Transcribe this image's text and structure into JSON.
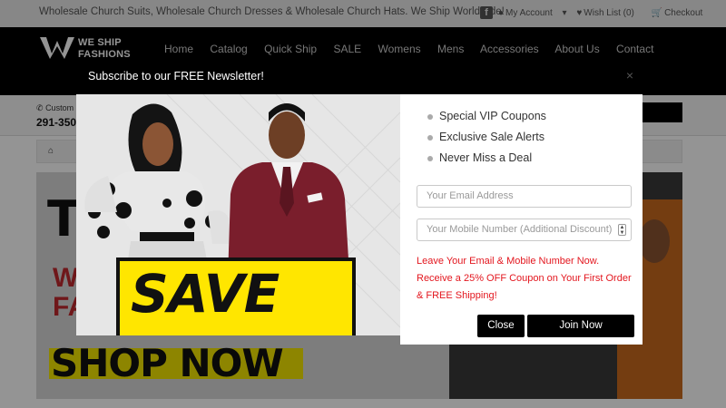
{
  "topbar": {
    "tagline": "Wholesale Church Suits, Wholesale Church Dresses & Wholesale Church Hats. We Ship Worldwide!",
    "facebook_glyph": "f",
    "account": "My Account",
    "wishlist": "Wish List (0)",
    "checkout": "Checkout"
  },
  "logo": {
    "line1": "WE SHIP",
    "line2": "FASHIONS"
  },
  "nav": {
    "items": [
      "Home",
      "Catalog",
      "Quick Ship",
      "SALE",
      "Womens",
      "Mens",
      "Accessories",
      "About Us",
      "Contact"
    ]
  },
  "subrow": {
    "customer": "Custom",
    "phone": "291-3500"
  },
  "hero": {
    "big_letter": "T",
    "red_line1": "W",
    "red_line2": "FA",
    "cta": "SHOP NOW"
  },
  "modal": {
    "title": "Subscribe to our FREE Newsletter!",
    "close_glyph": "×",
    "image_text": "SAVE",
    "benefits": [
      "Special VIP Coupons",
      "Exclusive Sale Alerts",
      "Never Miss a Deal"
    ],
    "email_placeholder": "Your Email Address",
    "mobile_placeholder": "Your Mobile Number (Additional Discount)",
    "promo_lines": [
      "Leave Your Email & Mobile Number Now.",
      "Receive a 25% OFF Coupon on Your First Order",
      "& FREE Shipping!"
    ],
    "close_label": "Close",
    "join_label": "Join Now"
  },
  "colors": {
    "brand_black": "#000000",
    "promo_red": "#e3161e",
    "save_yellow": "#ffe600",
    "suit_burgundy": "#7a1e2c"
  }
}
